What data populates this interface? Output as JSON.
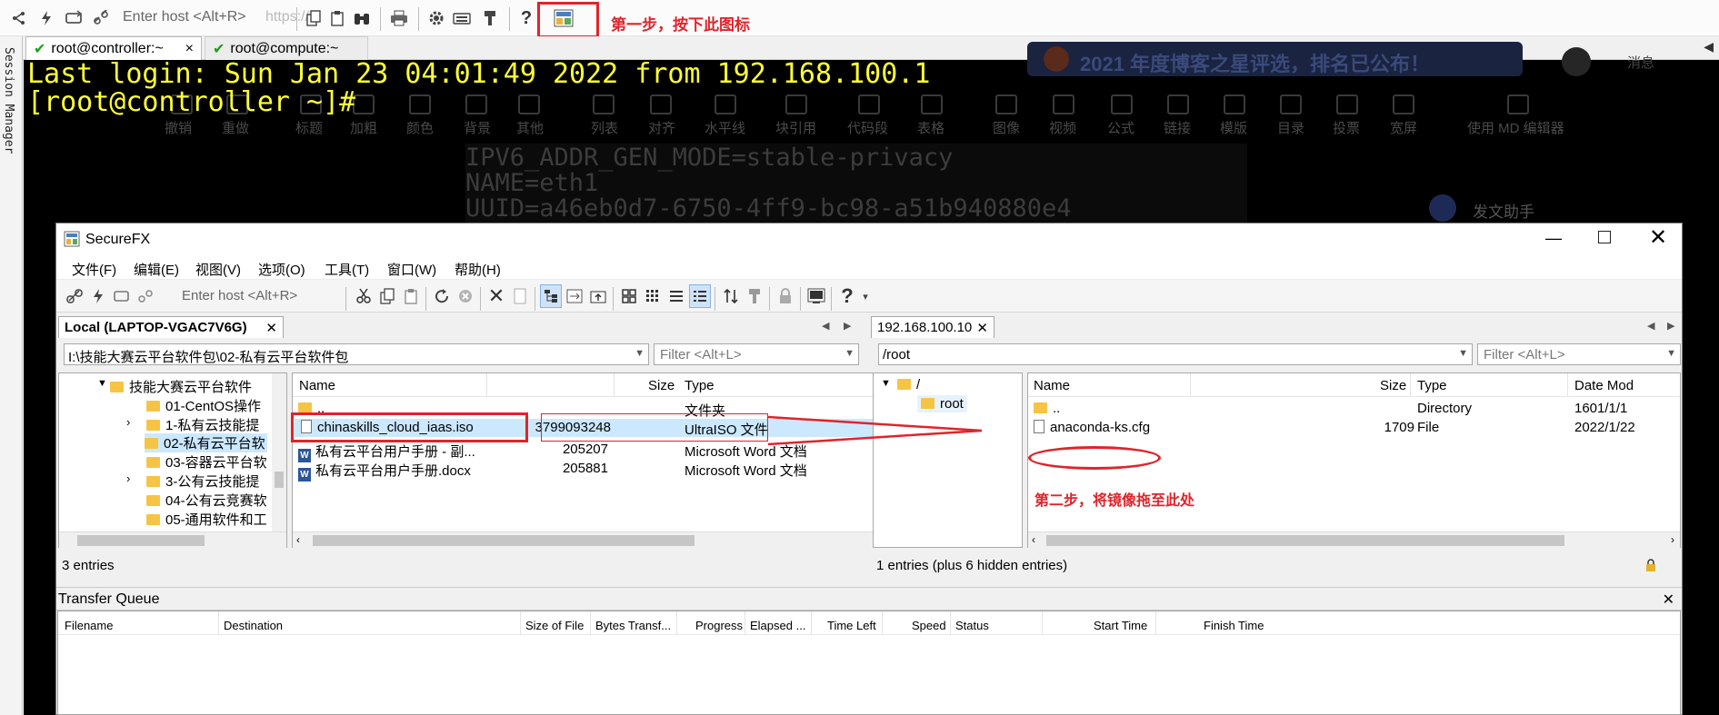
{
  "crt": {
    "host_placeholder": "Enter host <Alt+R>",
    "url_ghost": "https://",
    "step1_annotation": "第一步，按下此图标",
    "tabs": [
      {
        "label": "root@controller:~",
        "close": "×"
      },
      {
        "label": "root@compute:~"
      }
    ],
    "session_manager": "Session Manager",
    "ghost_banner": "2021 年度博客之星评选，排名已公布！",
    "ghost_toolbar": [
      "撤销",
      "重做",
      "标题",
      "加粗",
      "颜色",
      "背景",
      "其他",
      "列表",
      "对齐",
      "水平线",
      "块引用",
      "代码段",
      "表格",
      "图像",
      "视频",
      "公式",
      "链接",
      "模版",
      "目录",
      "投票",
      "宽屏",
      "使用 MD 编辑器"
    ],
    "ghost_helper": "发文助手",
    "ghost_msg": "消息",
    "terminal_lines": [
      "Last login: Sun Jan 23 04:01:49 2022 from 192.168.100.1",
      "[root@controller ~]#"
    ],
    "ghost_terminal_lines": [
      "IPV6_ADDR_GEN_MODE=stable-privacy",
      "NAME=eth1",
      "UUID=a46eb0d7-6750-4ff9-bc98-a51b940880e4"
    ]
  },
  "fx": {
    "title": "SecureFX",
    "menu": [
      "文件(F)",
      "编辑(E)",
      "视图(V)",
      "选项(O)",
      "工具(T)",
      "窗口(W)",
      "帮助(H)"
    ],
    "host_placeholder": "Enter host <Alt+R>",
    "local": {
      "tab_label": "Local (LAPTOP-VGAC7V6G)",
      "path": "I:\\技能大赛云平台软件包\\02-私有云平台软件包",
      "filter_placeholder": "Filter <Alt+L>",
      "tree": [
        "技能大赛云平台软件",
        "01-CentOS操作",
        "1-私有云技能提",
        "02-私有云平台软",
        "03-容器云平台软",
        "3-公有云技能提",
        "04-公有云竞赛软",
        "05-通用软件和工"
      ],
      "columns": {
        "name": "Name",
        "size": "Size",
        "type": "Type"
      },
      "files": [
        {
          "name": "..",
          "size": "",
          "type": "文件夹"
        },
        {
          "name": "chinaskills_cloud_iaas.iso",
          "size": "3799093248",
          "type": "UltraISO 文件"
        },
        {
          "name": "私有云平台用户手册 - 副...",
          "size": "205207",
          "type": "Microsoft Word 文档"
        },
        {
          "name": "私有云平台用户手册.docx",
          "size": "205881",
          "type": "Microsoft Word 文档"
        }
      ],
      "status": "3 entries"
    },
    "remote": {
      "tab_label": "192.168.100.10",
      "path": "/root",
      "filter_placeholder": "Filter <Alt+L>",
      "tree": [
        "/",
        "root"
      ],
      "columns": {
        "name": "Name",
        "size": "Size",
        "type": "Type",
        "date": "Date Mod"
      },
      "files": [
        {
          "name": "..",
          "size": "",
          "type": "Directory",
          "date": "1601/1/1"
        },
        {
          "name": "anaconda-ks.cfg",
          "size": "1709",
          "type": "File",
          "date": "2022/1/22"
        }
      ],
      "status": "1 entries (plus 6 hidden entries)",
      "step2_annotation": "第二步，将镜像拖至此处"
    },
    "transfer_queue": {
      "title": "Transfer Queue",
      "columns": [
        "Filename",
        "Destination",
        "Size of File",
        "Bytes Transf...",
        "Progress",
        "Elapsed ...",
        "Time Left",
        "Speed",
        "Status",
        "Start Time",
        "Finish Time"
      ]
    }
  },
  "colors": {
    "annotation_red": "#e0242a",
    "terminal_yellow": "#ffff35",
    "selection_blue": "#cce8ff"
  }
}
